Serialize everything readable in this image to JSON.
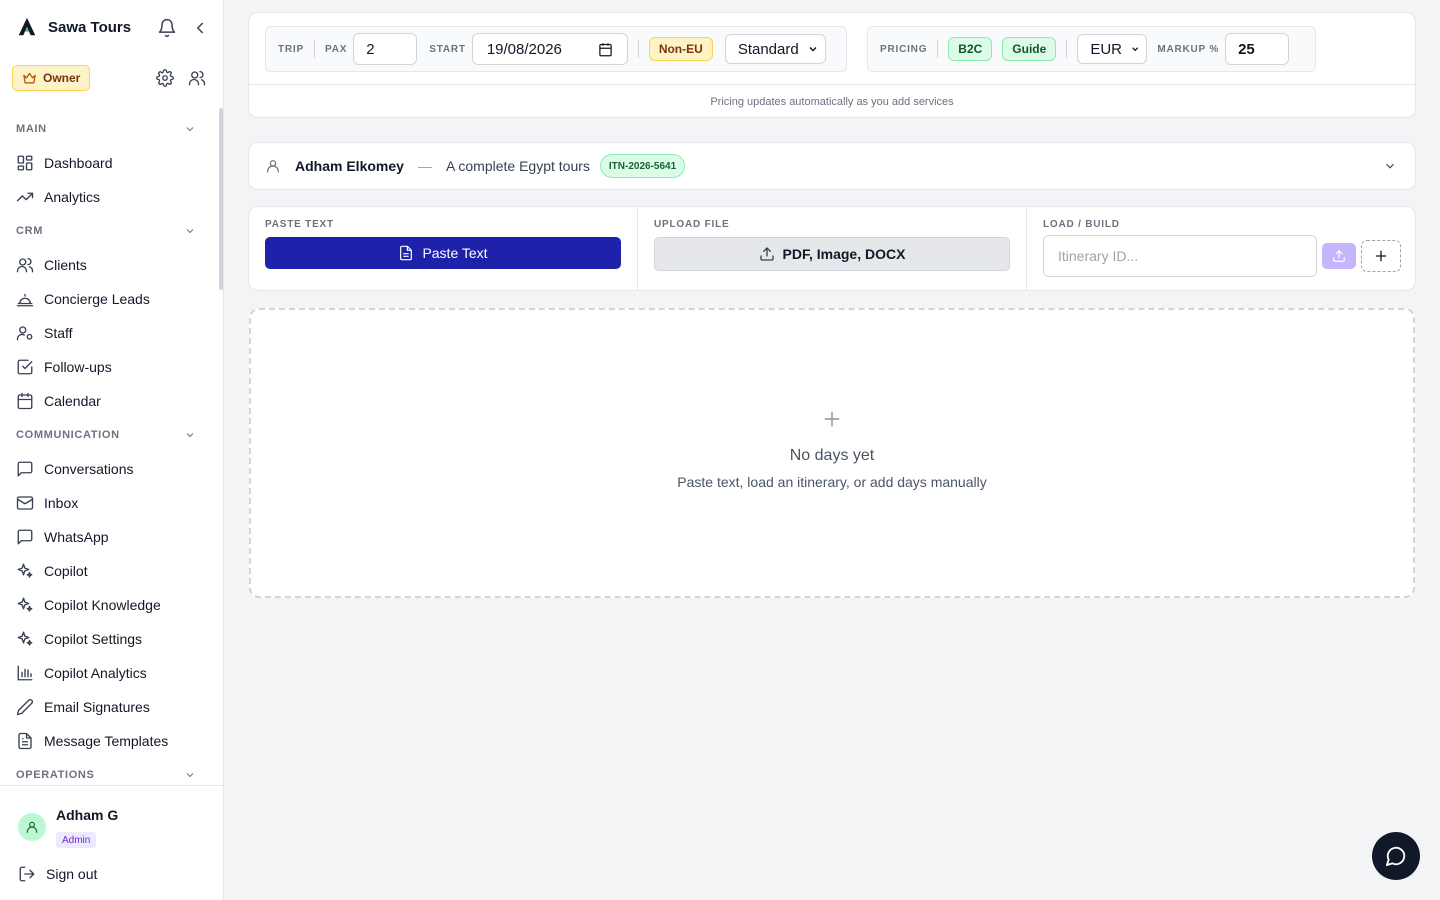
{
  "brand": {
    "name": "Sawa Tours",
    "icon": "mountain-logo"
  },
  "header": {
    "role_badge": "Owner"
  },
  "sidebar": {
    "sections": [
      {
        "title": "MAIN",
        "items": [
          {
            "label": "Dashboard",
            "icon": "grid-icon"
          },
          {
            "label": "Analytics",
            "icon": "trend-icon"
          }
        ]
      },
      {
        "title": "CRM",
        "items": [
          {
            "label": "Clients",
            "icon": "users-icon"
          },
          {
            "label": "Concierge Leads",
            "icon": "bell-service-icon"
          },
          {
            "label": "Staff",
            "icon": "user-gear-icon"
          },
          {
            "label": "Follow-ups",
            "icon": "checkbox-icon"
          },
          {
            "label": "Calendar",
            "icon": "calendar-icon"
          }
        ]
      },
      {
        "title": "COMMUNICATION",
        "items": [
          {
            "label": "Conversations",
            "icon": "chat-icon"
          },
          {
            "label": "Inbox",
            "icon": "mail-icon"
          },
          {
            "label": "WhatsApp",
            "icon": "chat-icon"
          },
          {
            "label": "Copilot",
            "icon": "sparkles-icon"
          },
          {
            "label": "Copilot Knowledge",
            "icon": "sparkles-icon"
          },
          {
            "label": "Copilot Settings",
            "icon": "sparkles-icon"
          },
          {
            "label": "Copilot Analytics",
            "icon": "bar-chart-icon"
          },
          {
            "label": "Email Signatures",
            "icon": "pen-icon"
          },
          {
            "label": "Message Templates",
            "icon": "file-icon"
          }
        ]
      },
      {
        "title": "OPERATIONS",
        "items": []
      }
    ]
  },
  "user": {
    "name": "Adham G",
    "role": "Admin",
    "sign_out": "Sign out"
  },
  "trip": {
    "label": "TRIP",
    "pax_label": "PAX",
    "pax_value": "2",
    "start_label": "START",
    "start_value": "19/08/2026",
    "nationality": "Non-EU",
    "tier": "Standard",
    "pricing_label": "PRICING",
    "pricing_tags": [
      "B2C",
      "Guide"
    ],
    "currency": "EUR",
    "markup_label": "MARKUP %",
    "markup_value": "25",
    "hint": "Pricing updates automatically as you add services"
  },
  "client": {
    "name": "Adham Elkomey",
    "separator": "—",
    "tour": "A complete Egypt tours",
    "itinerary_id": "ITN-2026-5641"
  },
  "import": {
    "paste": {
      "label": "PASTE TEXT",
      "button": "Paste Text"
    },
    "upload": {
      "label": "UPLOAD FILE",
      "button": "PDF, Image, DOCX"
    },
    "load": {
      "label": "LOAD / BUILD",
      "placeholder": "Itinerary ID..."
    }
  },
  "empty": {
    "title": "No days yet",
    "subtitle": "Paste text, load an itinerary, or add days manually"
  },
  "colors": {
    "primary": "#1e22aa",
    "accent_amber": "#fef3c7",
    "accent_green": "#dcfce7",
    "fab": "#111827"
  }
}
